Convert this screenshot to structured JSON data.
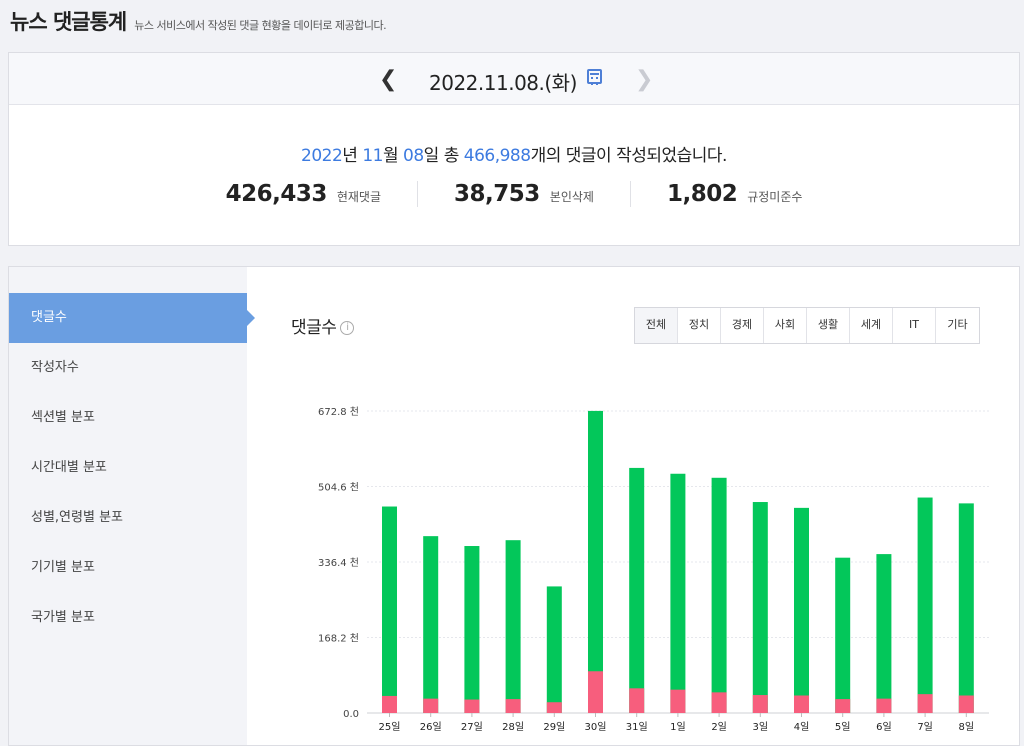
{
  "header": {
    "title": "뉴스 댓글통계",
    "subtitle": "뉴스 서비스에서 작성된 댓글 현황을 데이터로 제공합니다."
  },
  "date_nav": {
    "date": "2022.11.08.(화)",
    "prev_icon": "chevron-left-icon",
    "next_icon": "chevron-right-icon",
    "calendar_icon": "calendar-icon"
  },
  "summary": {
    "year": "2022",
    "year_unit": "년",
    "month": "11",
    "month_unit": "월",
    "day": "08",
    "day_unit": "일",
    "prefix": "총",
    "total": "466,988",
    "suffix": "개의 댓글이 작성되었습니다."
  },
  "stats": [
    {
      "value": "426,433",
      "label": "현재댓글"
    },
    {
      "value": "38,753",
      "label": "본인삭제"
    },
    {
      "value": "1,802",
      "label": "규정미준수"
    }
  ],
  "menu": [
    {
      "label": "댓글수",
      "active": true
    },
    {
      "label": "작성자수"
    },
    {
      "label": "섹션별 분포"
    },
    {
      "label": "시간대별 분포"
    },
    {
      "label": "성별,연령별 분포"
    },
    {
      "label": "기기별 분포"
    },
    {
      "label": "국가별 분포"
    }
  ],
  "chart_title": "댓글수",
  "chart_info_icon": "info-icon",
  "tabs": [
    {
      "label": "전체",
      "active": true
    },
    {
      "label": "정치"
    },
    {
      "label": "경제"
    },
    {
      "label": "사회"
    },
    {
      "label": "생활"
    },
    {
      "label": "세계"
    },
    {
      "label": "IT"
    },
    {
      "label": "기타"
    }
  ],
  "chart_data": {
    "type": "bar",
    "stacked": true,
    "categories": [
      "25일",
      "26일",
      "27일",
      "28일",
      "29일",
      "30일",
      "31일",
      "1일",
      "2일",
      "3일",
      "4일",
      "5일",
      "6일",
      "7일",
      "8일"
    ],
    "series": [
      {
        "color": "#03c75a",
        "values": [
          460,
          394,
          372,
          385,
          282,
          673,
          546,
          533,
          524,
          470,
          457,
          346,
          354,
          480,
          467
        ]
      },
      {
        "color": "#f75e7d",
        "values": [
          38,
          32,
          30,
          31,
          24,
          93,
          55,
          52,
          46,
          40,
          39,
          31,
          32,
          42,
          39
        ]
      }
    ],
    "ylim": [
      0,
      672.8
    ],
    "yticks": [
      "0.0",
      "168.2 천",
      "336.4 천",
      "504.6 천",
      "672.8 천"
    ],
    "ytick_values": [
      0,
      168.2,
      336.4,
      504.6,
      672.8
    ],
    "grid": true
  }
}
